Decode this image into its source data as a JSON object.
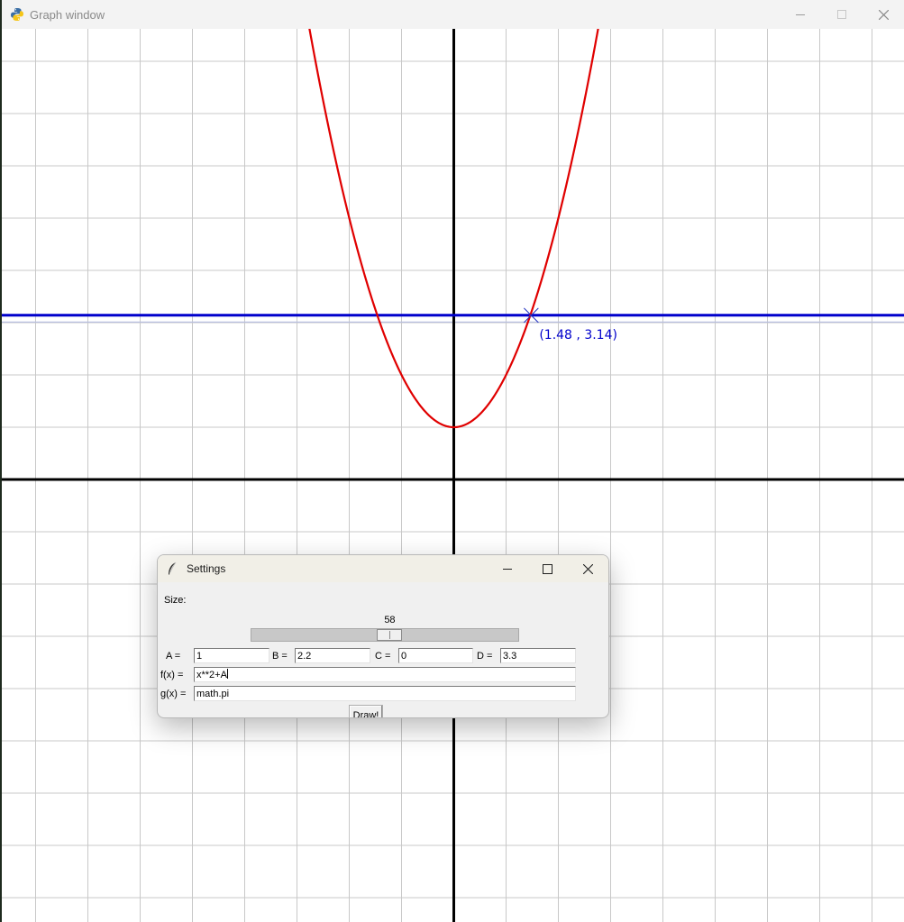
{
  "graph_window": {
    "title": "Graph window",
    "icon": "python-icon",
    "controls": {
      "minimize": "minimize-icon",
      "maximize": "maximize-icon",
      "close": "close-icon"
    },
    "colors": {
      "grid": "#c8c8c8",
      "axes": "#000000",
      "f_curve": "#e00000",
      "g_curve": "#0000cc",
      "background": "#ffffff"
    },
    "intersection_label": "(1.48 , 3.14)"
  },
  "chart_data": {
    "type": "line",
    "grid": true,
    "grid_spacing": 1,
    "xlim": [
      -8.6,
      8.6
    ],
    "ylim": [
      -8.5,
      8.6
    ],
    "series": [
      {
        "name": "f(x)",
        "expression": "x**2+A",
        "color": "#e00000"
      },
      {
        "name": "g(x)",
        "expression": "math.pi",
        "color": "#0000cc"
      }
    ],
    "intersection": {
      "x": 1.48,
      "y": 3.14
    }
  },
  "settings": {
    "title": "Settings",
    "icon": "feather-icon",
    "size_label": "Size:",
    "size_value": "58",
    "size_fraction": 0.52,
    "a_label": "A =",
    "a_value": "1",
    "b_label": "B =",
    "b_value": "2.2",
    "c_label": "C =",
    "c_value": "0",
    "d_label": "D =",
    "d_value": "3.3",
    "f_label": "f(x) =",
    "f_value": "x**2+A",
    "g_label": "g(x) =",
    "g_value": "math.pi",
    "draw_label": "Draw!"
  }
}
